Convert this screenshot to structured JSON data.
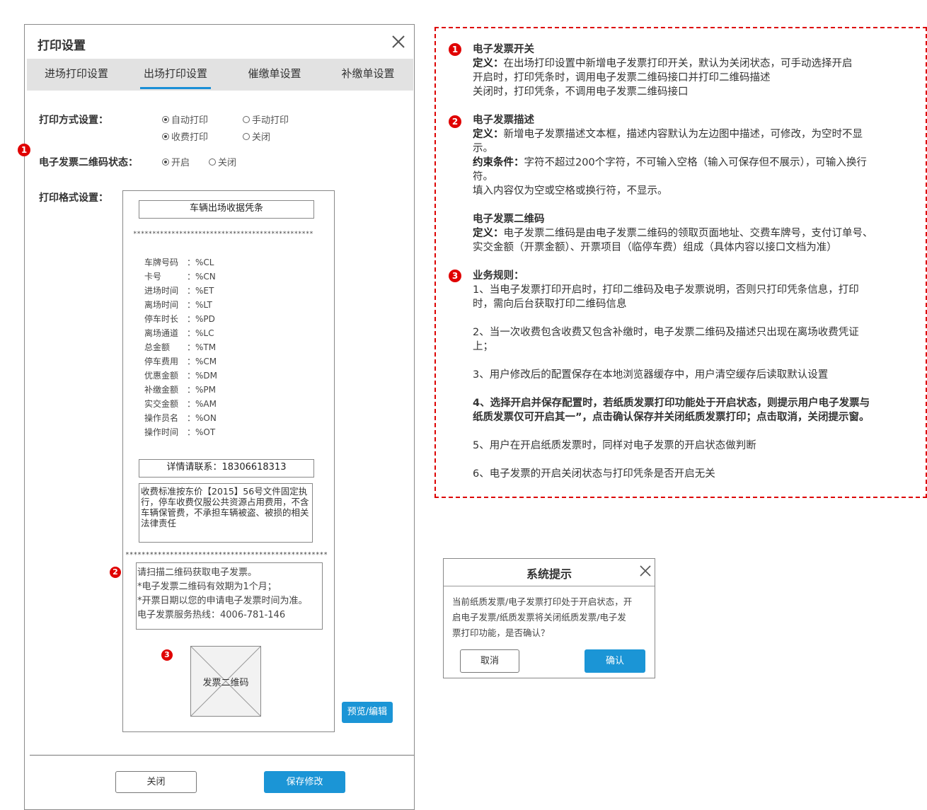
{
  "dialog": {
    "title": "打印设置",
    "tabs": [
      "进场打印设置",
      "出场打印设置",
      "催缴单设置",
      "补缴单设置"
    ],
    "active_tab": "出场打印设置",
    "print_mode_label": "打印方式设置：",
    "print_mode_options": [
      "自动打印",
      "手动打印",
      "收费打印",
      "关闭"
    ],
    "einvoice_label": "电子发票二维码状态：",
    "einvoice_options": [
      "开启",
      "关闭"
    ],
    "format_label": "打印格式设置：",
    "close_button": "关闭",
    "save_button": "保存修改",
    "preview_button": "预览/编辑"
  },
  "receipt": {
    "title": "车辆出场收据凭条",
    "stars_top": "***********************************************",
    "stars_bottom": "**************************************************",
    "fields": [
      {
        "k": "车牌号码",
        "v": "%CL"
      },
      {
        "k": "卡号",
        "v": "%CN"
      },
      {
        "k": "进场时间",
        "v": "%ET"
      },
      {
        "k": "离场时间",
        "v": "%LT"
      },
      {
        "k": "停车时长",
        "v": "%PD"
      },
      {
        "k": "离场通道",
        "v": "%LC"
      },
      {
        "k": "总金额",
        "v": "%TM"
      },
      {
        "k": "停车费用",
        "v": "%CM"
      },
      {
        "k": "优惠金额",
        "v": "%DM"
      },
      {
        "k": "补缴金额",
        "v": "%PM"
      },
      {
        "k": "实交金额",
        "v": "%AM"
      },
      {
        "k": "操作员名",
        "v": "%ON"
      },
      {
        "k": "操作时间",
        "v": "%OT"
      }
    ],
    "contact": "详情请联系：18306618313",
    "notice": "收费标准按东价【2015】56号文件固定执行，停车收费仅服公共资源占用费用，不含车辆保管费，不承担车辆被盗、被损的相关法律责任",
    "einvoice_desc": [
      "请扫描二维码获取电子发票。",
      "*电子发票二维码有效期为1个月；",
      "*开票日期以您的申请电子发票时间为准。",
      "电子发票服务热线：4006-781-146"
    ],
    "qr_label": "发票二维码"
  },
  "badges": [
    "1",
    "2",
    "3"
  ],
  "notes": {
    "s1_title": "电子发票开关",
    "s1_def_label": "定义：",
    "s1_def": "在出场打印设置中新增电子发票打印开关，默认为关闭状态，可手动选择开启",
    "s1_l2": "开启时，打印凭条时，调用电子发票二维码接口并打印二维码描述",
    "s1_l3": "关闭时，打印凭条，不调用电子发票二维码接口",
    "s2_title": "电子发票描述",
    "s2_def_label": "定义：",
    "s2_def": "新增电子发票描述文本框，描述内容默认为左边图中描述，可修改，为空时不显",
    "s2_def2": "示。",
    "s2_cons_label": "约束条件：",
    "s2_cons": "字符不超过200个字符，不可输入空格（输入可保存但不展示），可输入换行",
    "s2_cons2": "符。",
    "s2_l5": "填入内容仅为空或空格或换行符，不显示。",
    "s2b_title": "电子发票二维码",
    "s2b_def_label": "定义：",
    "s2b_def": "电子发票二维码是由电子发票二维码的领取页面地址、交费车牌号，支付订单号、",
    "s2b_def2": "实交金额（开票金额）、开票项目（临停车费）组成（具体内容以接口文档为准）",
    "s3_title": "业务规则：",
    "r1a": "1、当电子发票打印开启时，打印二维码及电子发票说明，否则只打印凭条信息，打印",
    "r1b": "时，需向后台获取打印二维码信息",
    "r2a": "2、当一次收费包含收费又包含补缴时，电子发票二维码及描述只出现在离场收费凭证",
    "r2b": "上；",
    "r3": "3、用户修改后的配置保存在本地浏览器缓存中，用户清空缓存后读取默认设置",
    "r4a": "4、选择开启并保存配置时，若纸质发票打印功能处于开启状态，则提示用户电子发票与",
    "r4b": "纸质发票仅可开启其一”，点击确认保存并关闭纸质发票打印；点击取消，关闭提示窗。",
    "r5": "5、用户在开启纸质发票时，同样对电子发票的开启状态做判断",
    "r6": "6、电子发票的开启关闭状态与打印凭条是否开启无关"
  },
  "tip": {
    "title": "系统提示",
    "lines": [
      "当前纸质发票/电子发票打印处于开启状态，开",
      "启电子发票/纸质发票将关闭纸质发票/电子发",
      "票打印功能，是否确认？"
    ],
    "cancel": "取消",
    "confirm": "确认"
  },
  "colors": {
    "accent": "#1b95d6",
    "badge": "#e00000",
    "dash": "#dd0000"
  }
}
